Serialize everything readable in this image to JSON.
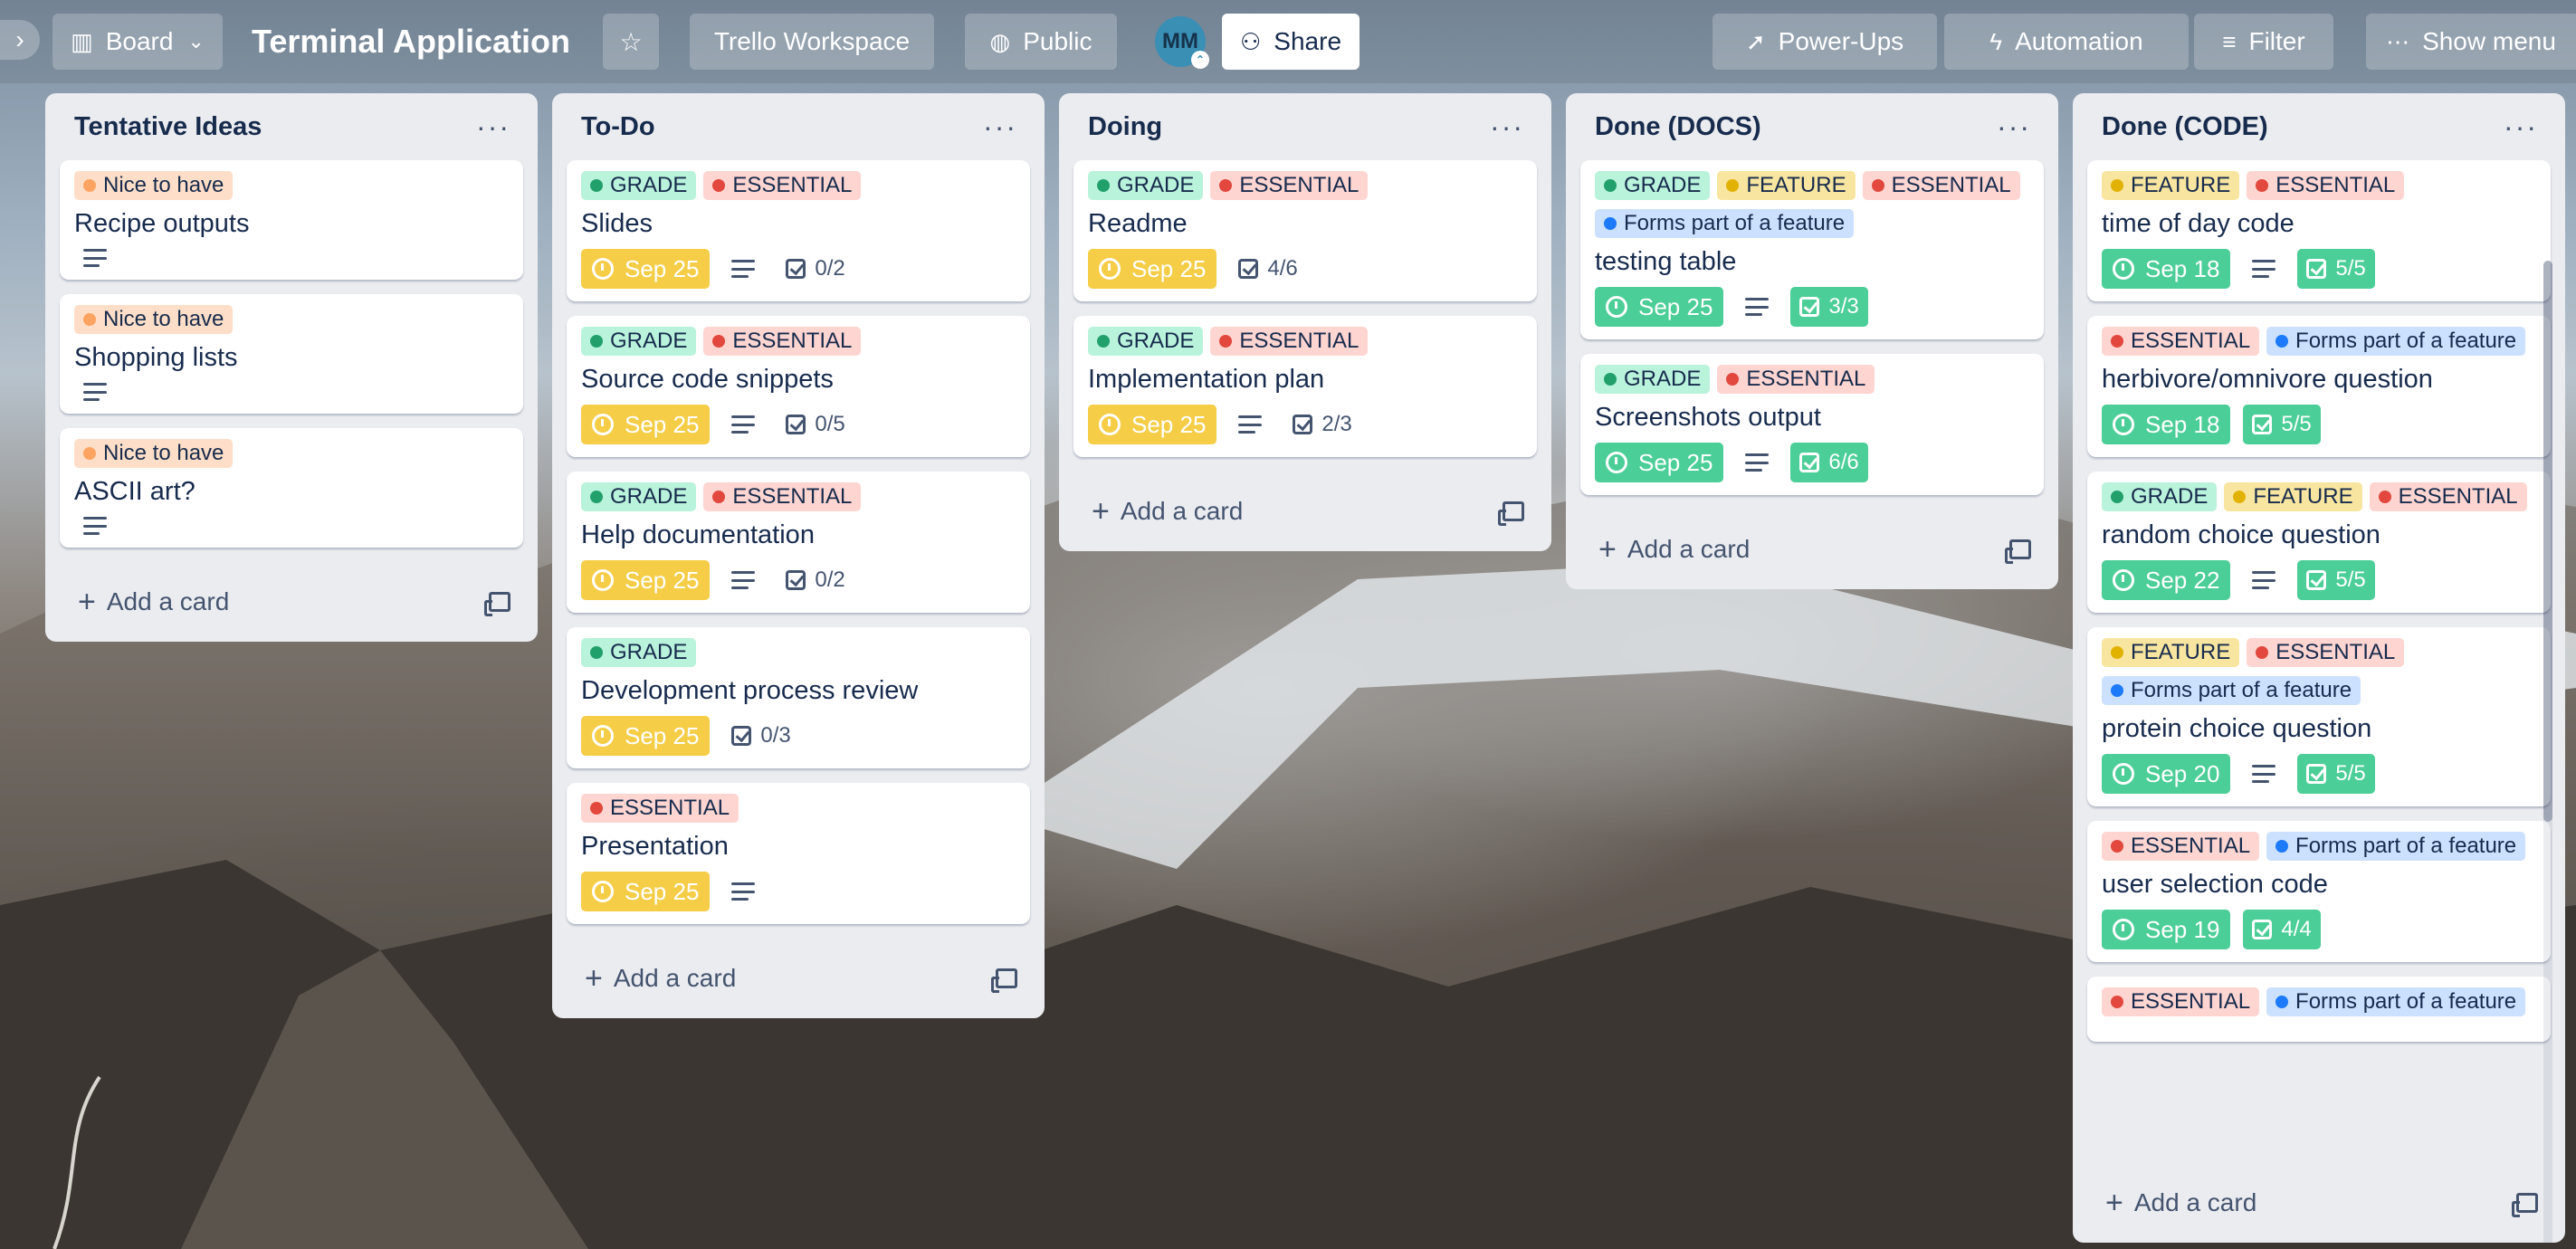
{
  "topbar": {
    "view": "Board",
    "board_title": "Terminal Application",
    "workspace": "Trello Workspace",
    "visibility": "Public",
    "avatar_initials": "MM",
    "share": "Share",
    "powerups": "Power-Ups",
    "automation": "Automation",
    "filter": "Filter",
    "show_menu": "Show menu"
  },
  "add_card": "Add a card",
  "lists": [
    {
      "title": "Tentative Ideas",
      "cards": [
        {
          "labels": [
            {
              "type": "nice",
              "text": "Nice to have"
            }
          ],
          "title": "Recipe outputs",
          "desc": true
        },
        {
          "labels": [
            {
              "type": "nice",
              "text": "Nice to have"
            }
          ],
          "title": "Shopping lists",
          "desc": true
        },
        {
          "labels": [
            {
              "type": "nice",
              "text": "Nice to have"
            }
          ],
          "title": "ASCII art?",
          "desc": true
        }
      ]
    },
    {
      "title": "To-Do",
      "cards": [
        {
          "labels": [
            {
              "type": "grade",
              "text": "GRADE"
            },
            {
              "type": "essential",
              "text": "ESSENTIAL"
            }
          ],
          "title": "Slides",
          "date": "Sep 25",
          "desc": true,
          "check": "0/2"
        },
        {
          "labels": [
            {
              "type": "grade",
              "text": "GRADE"
            },
            {
              "type": "essential",
              "text": "ESSENTIAL"
            }
          ],
          "title": "Source code snippets",
          "date": "Sep 25",
          "desc": true,
          "check": "0/5"
        },
        {
          "labels": [
            {
              "type": "grade",
              "text": "GRADE"
            },
            {
              "type": "essential",
              "text": "ESSENTIAL"
            }
          ],
          "title": "Help documentation",
          "date": "Sep 25",
          "desc": true,
          "check": "0/2"
        },
        {
          "labels": [
            {
              "type": "grade",
              "text": "GRADE"
            }
          ],
          "title": "Development process review",
          "date": "Sep 25",
          "check": "0/3"
        },
        {
          "labels": [
            {
              "type": "essential",
              "text": "ESSENTIAL"
            }
          ],
          "title": "Presentation",
          "date": "Sep 25",
          "desc": true
        }
      ]
    },
    {
      "title": "Doing",
      "cards": [
        {
          "labels": [
            {
              "type": "grade",
              "text": "GRADE"
            },
            {
              "type": "essential",
              "text": "ESSENTIAL"
            }
          ],
          "title": "Readme",
          "date": "Sep 25",
          "check": "4/6"
        },
        {
          "labels": [
            {
              "type": "grade",
              "text": "GRADE"
            },
            {
              "type": "essential",
              "text": "ESSENTIAL"
            }
          ],
          "title": "Implementation plan",
          "date": "Sep 25",
          "desc": true,
          "check": "2/3"
        }
      ]
    },
    {
      "title": "Done (DOCS)",
      "cards": [
        {
          "labels": [
            {
              "type": "grade",
              "text": "GRADE"
            },
            {
              "type": "feature",
              "text": "FEATURE"
            },
            {
              "type": "essential",
              "text": "ESSENTIAL"
            },
            {
              "type": "forms",
              "text": "Forms part of a feature"
            }
          ],
          "title": "testing table",
          "date": "Sep 25",
          "date_done": true,
          "desc": true,
          "check": "3/3",
          "check_done": true
        },
        {
          "labels": [
            {
              "type": "grade",
              "text": "GRADE"
            },
            {
              "type": "essential",
              "text": "ESSENTIAL"
            }
          ],
          "title": "Screenshots output",
          "date": "Sep 25",
          "date_done": true,
          "desc": true,
          "check": "6/6",
          "check_done": true
        }
      ]
    },
    {
      "title": "Done (CODE)",
      "cards": [
        {
          "labels": [
            {
              "type": "feature",
              "text": "FEATURE"
            },
            {
              "type": "essential",
              "text": "ESSENTIAL"
            }
          ],
          "title": "time of day code",
          "date": "Sep 18",
          "date_done": true,
          "desc": true,
          "check": "5/5",
          "check_done": true
        },
        {
          "labels": [
            {
              "type": "essential",
              "text": "ESSENTIAL"
            },
            {
              "type": "forms",
              "text": "Forms part of a feature"
            }
          ],
          "title": "herbivore/omnivore question",
          "date": "Sep 18",
          "date_done": true,
          "check": "5/5",
          "check_done": true
        },
        {
          "labels": [
            {
              "type": "grade",
              "text": "GRADE"
            },
            {
              "type": "feature",
              "text": "FEATURE"
            },
            {
              "type": "essential",
              "text": "ESSENTIAL"
            }
          ],
          "title": "random choice question",
          "date": "Sep 22",
          "date_done": true,
          "desc": true,
          "check": "5/5",
          "check_done": true
        },
        {
          "labels": [
            {
              "type": "feature",
              "text": "FEATURE"
            },
            {
              "type": "essential",
              "text": "ESSENTIAL"
            },
            {
              "type": "forms",
              "text": "Forms part of a feature"
            }
          ],
          "title": "protein choice question",
          "date": "Sep 20",
          "date_done": true,
          "desc": true,
          "check": "5/5",
          "check_done": true
        },
        {
          "labels": [
            {
              "type": "essential",
              "text": "ESSENTIAL"
            },
            {
              "type": "forms",
              "text": "Forms part of a feature"
            }
          ],
          "title": "user selection code",
          "date": "Sep 19",
          "date_done": true,
          "check": "4/4",
          "check_done": true
        },
        {
          "labels": [
            {
              "type": "essential",
              "text": "ESSENTIAL"
            },
            {
              "type": "forms",
              "text": "Forms part of a feature"
            }
          ],
          "title": "",
          "partial": true
        }
      ]
    }
  ]
}
